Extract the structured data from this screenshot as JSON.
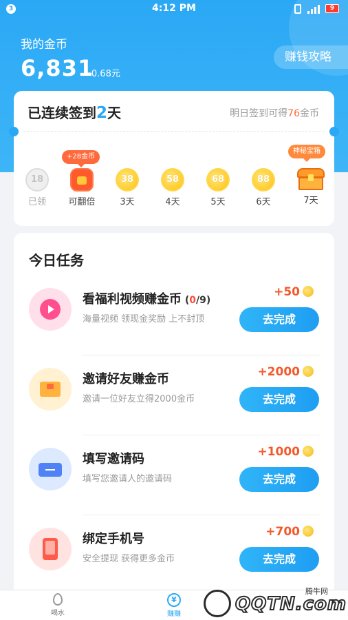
{
  "status_bar": {
    "notification_count": "3",
    "time": "4:12 PM",
    "battery": "9"
  },
  "header": {
    "title": "我的金币",
    "coin_balance": "6,831",
    "rmb_equiv": "≈0.68元",
    "strategy_button": "赚钱攻略"
  },
  "signin": {
    "streak_prefix": "已连续签到",
    "streak_days": "2",
    "streak_suffix": "天",
    "tomorrow_prefix": "明日签到可得",
    "tomorrow_coins": "76",
    "tomorrow_suffix": "金币",
    "double_tip": "+28金币",
    "chest_tip": "神秘宝箱",
    "days": [
      {
        "coin": "18",
        "label": "已领",
        "state": "done"
      },
      {
        "coin": "",
        "label": "可翻倍",
        "state": "double"
      },
      {
        "coin": "38",
        "label": "3天",
        "state": "pending"
      },
      {
        "coin": "58",
        "label": "4天",
        "state": "pending"
      },
      {
        "coin": "68",
        "label": "5天",
        "state": "pending"
      },
      {
        "coin": "88",
        "label": "6天",
        "state": "pending"
      },
      {
        "coin": "",
        "label": "7天",
        "state": "chest"
      }
    ]
  },
  "tasks": {
    "title": "今日任务",
    "items": [
      {
        "name": "看福利视频赚金币",
        "progress_open": " (",
        "progress_cur": "0",
        "progress_total": "/9)",
        "desc": "海量视频 领现金奖励 上不封顶",
        "reward": "+50",
        "button": "去完成",
        "icon": "video-play-icon"
      },
      {
        "name": "邀请好友赚金币",
        "desc": "邀请一位好友立得2000金币",
        "reward": "+2000",
        "button": "去完成",
        "icon": "envelope-icon"
      },
      {
        "name": "填写邀请码",
        "desc": "填写您邀请人的邀请码",
        "reward": "+1000",
        "button": "去完成",
        "icon": "ticket-icon"
      },
      {
        "name": "绑定手机号",
        "desc": "安全提现 获得更多金币",
        "reward": "+700",
        "button": "去完成",
        "icon": "phone-icon"
      }
    ]
  },
  "bottom_nav": {
    "items": [
      {
        "label": "喝水",
        "icon": "water-drop-icon",
        "active": false
      },
      {
        "label": "赚赚",
        "icon": "yuan-coin-icon",
        "glyph": "¥",
        "active": true
      }
    ]
  },
  "watermark": {
    "brand": "QQTN.com",
    "site": "腾牛网"
  },
  "colors": {
    "primary": "#2ba8f5",
    "accent": "#ff6a3d",
    "reward": "#f25a2c"
  }
}
